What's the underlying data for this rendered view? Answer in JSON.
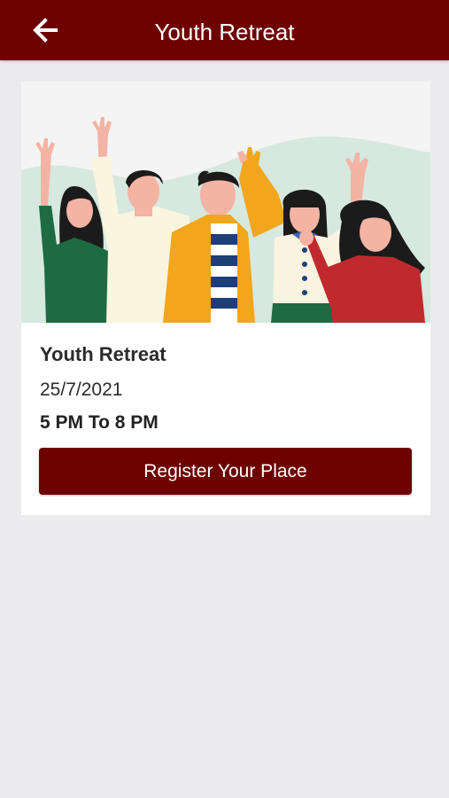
{
  "colors": {
    "brand": "#6e0000",
    "background": "#ebebed",
    "card": "#ffffff"
  },
  "app_bar": {
    "back_icon": "arrow-left-icon",
    "title": "Youth Retreat"
  },
  "event_card": {
    "image": "group-of-young-people-waving-illustration",
    "title": "Youth Retreat",
    "date": "25/7/2021",
    "time": "5 PM To 8 PM",
    "register_label": "Register Your Place"
  }
}
